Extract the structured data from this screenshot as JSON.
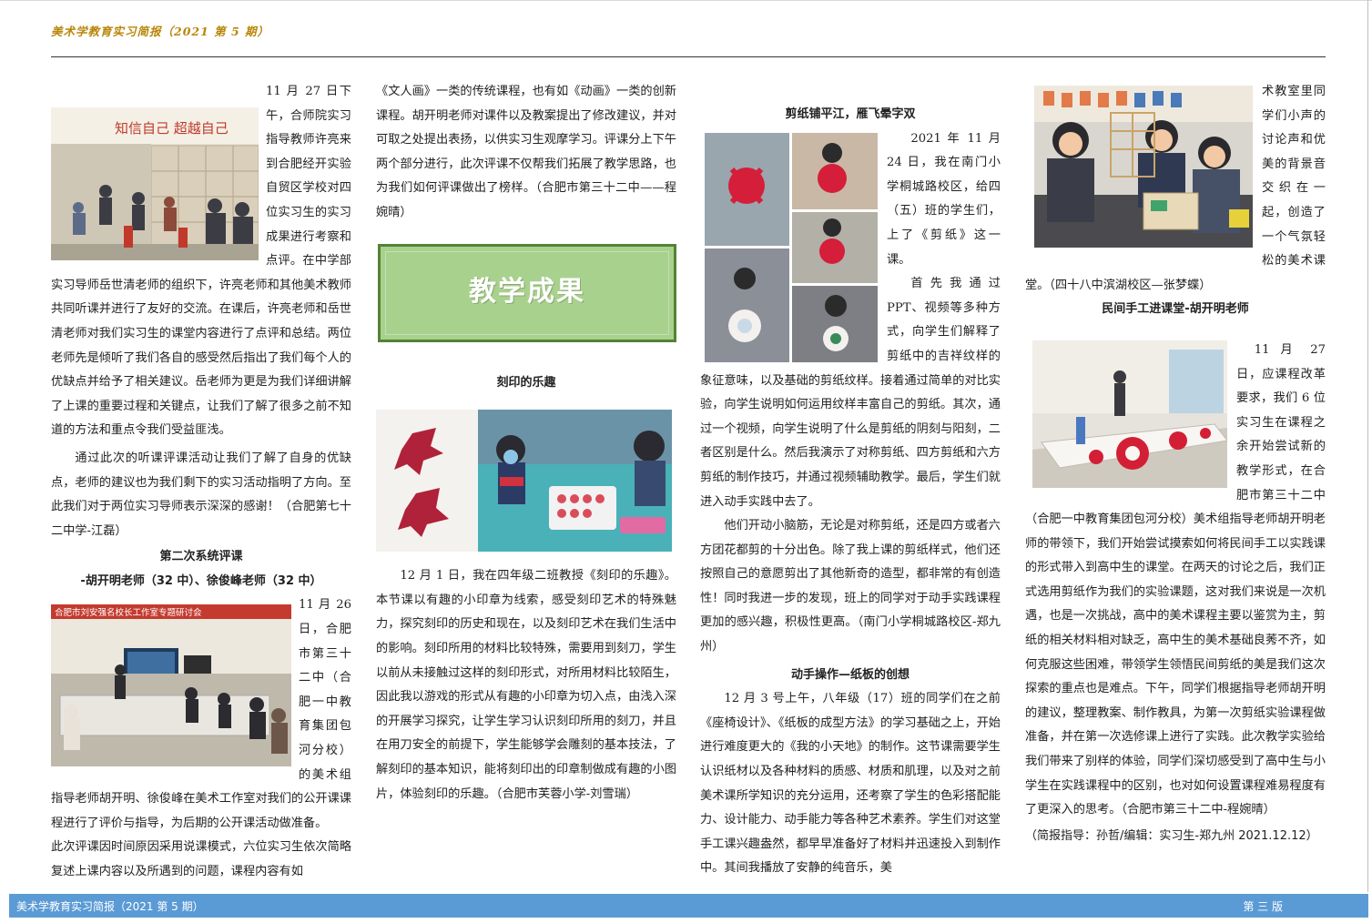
{
  "masthead": "美术学教育实习简报（2021 第 5 期）",
  "footer": {
    "left": "美术学教育实习简报（2021 第 5 期）",
    "right": "第 三 版"
  },
  "col1": {
    "p1a": "11 月 27 日下午，合师院实习指导教师许亮来到合肥经开实验自贸区学校对四位实习生的实习成果进行考察和点评。在中学部实习导师岳世清老师的组织下，许亮老师和其他美术教师共同听课并进行了友好的交流。在课后，许亮老师和岳世清老师对我们实习生的课堂内容进行了点评和总结。两位老师先是倾听了我们各自的感受然后指出了我们每个人的优缺点并给予了相关建议。岳老师为更是为我们详细讲解了上课的重要过程和关键点，让我们了解了很多之前不知道的方法和重点令我们受益匪浅。",
    "p2": "通过此次的听课评课活动让我们了解了自身的优缺点，老师的建议也为我们剩下的实习活动指明了方向。至此我们对于两位实习导师表示深深的感谢！（合肥第七十二中学-江磊）",
    "heading1": "第二次系统评课",
    "heading2": "-胡开明老师（32 中）、徐俊峰老师（32 中）",
    "p3": "11 月 26 日，合肥市第三十二中（合肥一中教育集团包河分校）的美术组指导老师胡开明、徐俊峰在美术工作室对我们的公开课课程进行了评价与指导，为后期的公开课活动做准备。",
    "p4": "此次评课因时间原因采用说课模式，六位实习生依次简略复述上课内容以及所遇到的问题，课程内容有如"
  },
  "col2": {
    "p1": "《文人画》一类的传统课程，也有如《动画》一类的创新课程。胡开明老师对课件以及教案提出了修改建议，并对可取之处提出表扬，以供实习生观摩学习。评课分上下午两个部分进行，此次评课不仅帮我们拓展了教学思路，也为我们如何评课做出了榜样。（合肥市第三十二中——程婉晴）",
    "banner": "教学成果",
    "heading": "刻印的乐趣",
    "p2": "12 月 1 日，我在四年级二班教授《刻印的乐趣》。本节课以有趣的小印章为线索，感受刻印艺术的特殊魅力，探究刻印的历史和现在，以及刻印艺术在我们生活中的影响。刻印所用的材料比较特殊，需要用到刻刀，学生以前从未接触过这样的刻印形式，对所用材料比较陌生，因此我以游戏的形式从有趣的小印章为切入点，由浅入深的开展学习探究，让学生学习认识刻印所用的刻刀，并且在用刀安全的前提下，学生能够学会雕刻的基本技法，了解刻印的基本知识，能将刻印出的印章制做成有趣的小图片，体验刻印的乐趣。（合肥市芙蓉小学-刘雪瑞）"
  },
  "col3": {
    "heading1": "剪纸铺平江，雁飞晕字双",
    "p1": "2021 年 11 月 24 日，我在南门小学桐城路校区，给四（五）班的学生们，上了《剪纸》这一课。",
    "p2": "首先我通过 PPT、视频等多种方式，向学生们解释了剪纸中的吉祥纹样的象征意味，以及基础的剪纸纹样。接着通过简单的对比实验，向学生说明如何运用纹样丰富自己的剪纸。其次，通过一个视频，向学生说明了什么是剪纸的阴刻与阳刻，二者区别是什么。然后我演示了对称剪纸、四方剪纸和六方剪纸的制作技巧，并通过视频辅助教学。最后，学生们就进入动手实践中去了。",
    "p3": "他们开动小脑筋，无论是对称剪纸，还是四方或者六方团花都剪的十分出色。除了我上课的剪纸样式，他们还按照自己的意愿剪出了其他新奇的造型，都非常的有创造性！同时我进一步的发现，班上的同学对于动手实践课程更加的感兴趣，积极性更高。（南门小学桐城路校区-郑九州）",
    "heading2": "动手操作—纸板的创想",
    "p4": "12 月 3 号上午，八年级（17）班的同学们在之前《座椅设计》、《纸板的成型方法》的学习基础之上，开始进行难度更大的《我的小天地》的制作。这节课需要学生认识纸材以及各种材料的质感、材质和肌理，以及对之前美术课所学知识的充分运用，还考察了学生的色彩搭配能力、设计能力、动手能力等各种艺术素养。学生们对这堂手工课兴趣盎然，都早早准备好了材料并迅速投入到制作中。其间我播放了安静的纯音乐，美"
  },
  "col4": {
    "p1": "术教室里同学们小声的讨论声和优美的背景音交织在一起，创造了一个气氛轻松的美术课堂。（四十八中滨湖校区—张梦蝶）",
    "heading": "民间手工进课堂-胡开明老师",
    "p2": "11 月 27 日，应课程改革要求，我们 6 位实习生在课程之余开始尝试新的教学形式，在合肥市第三十二中（合肥一中教育集团包河分校）美术组指导老师胡开明老师的带领下，我们开始尝试摸索如何将民间手工以实践课的形式带入到高中生的课堂。在两天的讨论之后，我们正式选用剪纸作为我们的实验课题，这对我们来说是一次机遇，也是一次挑战，高中的美术课程主要以鉴赏为主，剪纸的相关材料相对缺乏，高中生的美术基础良莠不齐，如何克服这些困难，带领学生领悟民间剪纸的美是我们这次探索的重点也是难点。下午，同学们根据指导老师胡开明的建议，整理教案、制作教具，为第一次剪纸实验课程做准备，并在第一次选修课上进行了实践。此次教学实验给我们带来了别样的体验，同学们深切感受到了高中生与小学生在实践课程中的区别，也对如何设置课程难易程度有了更深入的思考。（合肥市第三十二中-程婉晴）",
    "credit": "（简报指导：孙哲/编辑：实习生-郑九州 2021.12.12）"
  },
  "photo_text": {
    "wall_slogan": "知信自己 超越自己",
    "classroom_banner": "合肥市刘安强名校长工作室专题研讨会"
  }
}
